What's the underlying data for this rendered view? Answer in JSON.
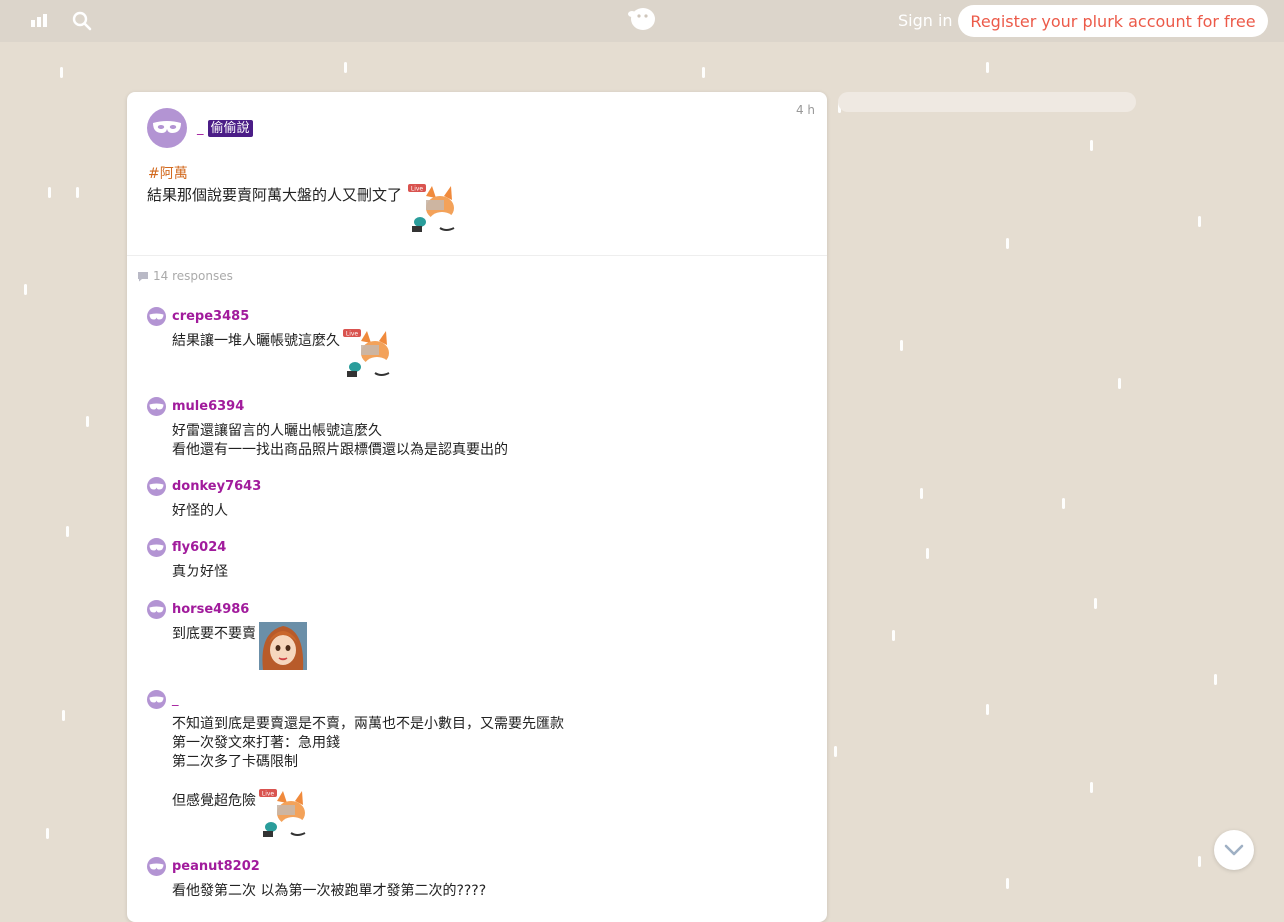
{
  "topbar": {
    "signin_label": "Sign in",
    "register_label": "Register your plurk account for free"
  },
  "post": {
    "time": "4 h",
    "author": "_",
    "qualifier": "偷偷說",
    "hashtag": "#阿萬",
    "text": "結果那個說要賣阿萬大盤的人又刪文了",
    "sticker_badge": "Live"
  },
  "responses_label": "14 responses",
  "responses": [
    {
      "name": "crepe3485",
      "lines": [
        "結果讓一堆人曬帳號這麼久"
      ],
      "sticker_badge": "Live"
    },
    {
      "name": "mule6394",
      "lines": [
        "好雷還讓留言的人曬出帳號這麼久",
        "看他還有一一找出商品照片跟標價還以為是認真要出的"
      ]
    },
    {
      "name": "donkey7643",
      "lines": [
        "好怪的人"
      ]
    },
    {
      "name": "fly6024",
      "lines": [
        "真ㄉ好怪"
      ]
    },
    {
      "name": "horse4986",
      "lines": [
        "到底要不要賣"
      ]
    },
    {
      "name": "_",
      "lines": [
        "不知道到底是要賣還是不賣，兩萬也不是小數目，又需要先匯款",
        "第一次發文來打著：急用錢",
        "第二次多了卡碼限制",
        "",
        "但感覺超危險"
      ],
      "sticker_badge": "Live"
    },
    {
      "name": "peanut8202",
      "lines": [
        "看他發第二次 以為第一次被跑單才發第二次的????"
      ]
    }
  ],
  "colors": {
    "background": "#e5ddd1",
    "accent_red": "#ec5a49",
    "name_purple": "#a11b9c",
    "qualifier_bg": "#4b1d87",
    "avatar_purple": "#b394d3"
  },
  "icons": [
    "stats-icon",
    "search-icon",
    "plurk-logo-icon",
    "mask-avatar-icon",
    "comment-icon",
    "fox-sticker-icon",
    "anime-girl-image",
    "chevron-down-icon"
  ]
}
